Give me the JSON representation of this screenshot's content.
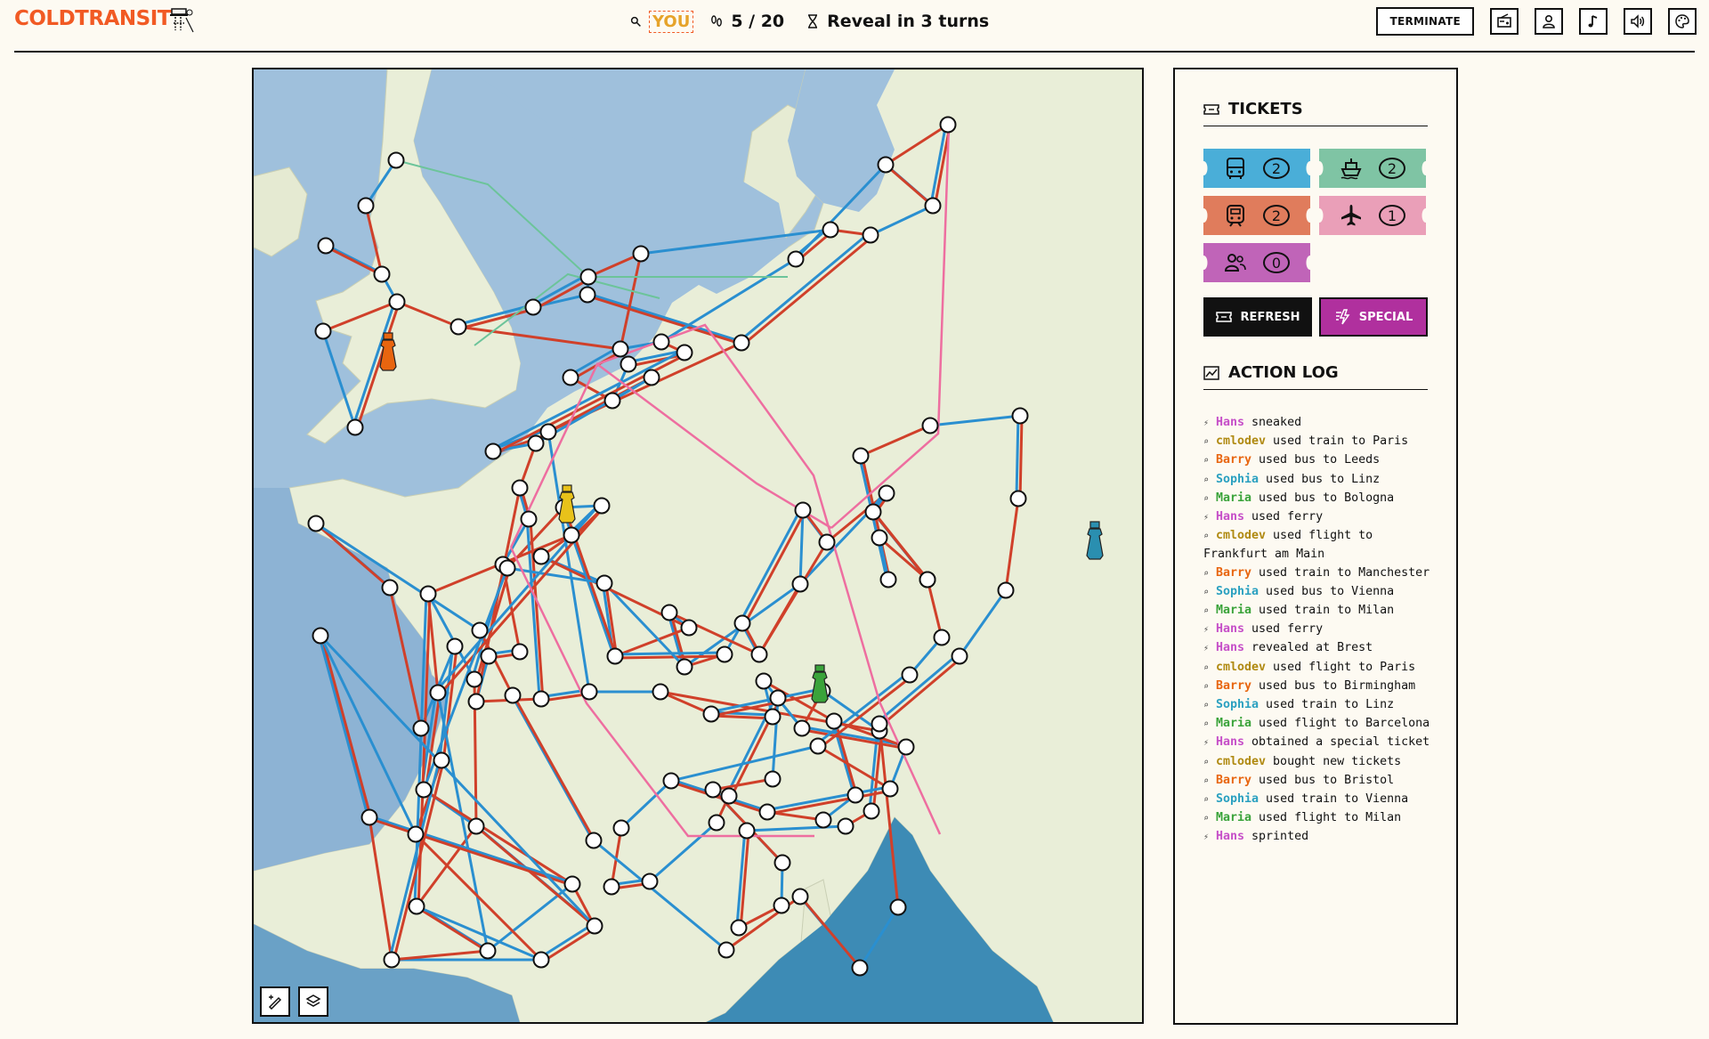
{
  "app": {
    "logo_text": "COLDTRANSIT"
  },
  "hud": {
    "player_tag": "YOU",
    "round_text": "5 / 20",
    "reveal_text": "Reveal in 3 turns"
  },
  "header": {
    "terminate_label": "TERMINATE",
    "icon_buttons": [
      "radio-icon",
      "profile-icon",
      "music-icon",
      "volume-icon",
      "palette-icon"
    ]
  },
  "map": {
    "controls": [
      "draw-tool-icon",
      "layers-icon"
    ],
    "players": [
      {
        "name": "Barry",
        "color": "#e8650f",
        "location": "Bristol"
      },
      {
        "name": "cmlodev",
        "color": "#e8c21a",
        "location": "Paris"
      },
      {
        "name": "Maria",
        "color": "#3aa33a",
        "location": "Milan"
      },
      {
        "name": "Sophia",
        "color": "#2a8fb0",
        "location": "Vienna"
      }
    ],
    "route_colors": {
      "train": "#d0402a",
      "bus": "#2a8fd0",
      "ferry": "#6cc49a",
      "flight": "#ee6ea0"
    }
  },
  "tickets": {
    "title": "TICKETS",
    "items": [
      {
        "type": "bus-icon",
        "count": "2",
        "color": "#4aaed8"
      },
      {
        "type": "ferry-icon",
        "count": "2",
        "color": "#7fc4a4"
      },
      {
        "type": "train-icon",
        "count": "2",
        "color": "#e07c5c"
      },
      {
        "type": "flight-icon",
        "count": "1",
        "color": "#ea9fb8"
      },
      {
        "type": "sneak-icon",
        "count": "0",
        "color": "#c064b8"
      }
    ],
    "refresh_label": "REFRESH",
    "special_label": "SPECIAL",
    "refresh_color": "#111111",
    "special_color": "#b0309e"
  },
  "action_log": {
    "title": "ACTION LOG",
    "player_colors": {
      "Hans": "#c64fc8",
      "cmlodev": "#b08a12",
      "Barry": "#e8650f",
      "Sophia": "#2aa0c0",
      "Maria": "#3aa33a"
    },
    "entries": [
      {
        "icon": "⚡",
        "who": "Hans",
        "text": " sneaked"
      },
      {
        "icon": "🔍",
        "who": "cmlodev",
        "text": " used train to Paris"
      },
      {
        "icon": "🔍",
        "who": "Barry",
        "text": " used bus to Leeds"
      },
      {
        "icon": "🔍",
        "who": "Sophia",
        "text": " used bus to Linz"
      },
      {
        "icon": "🔍",
        "who": "Maria",
        "text": " used bus to Bologna"
      },
      {
        "icon": "⚡",
        "who": "Hans",
        "text": " used ferry"
      },
      {
        "icon": "🔍",
        "who": "cmlodev",
        "text": " used flight to Frankfurt am Main"
      },
      {
        "icon": "🔍",
        "who": "Barry",
        "text": " used train to Manchester"
      },
      {
        "icon": "🔍",
        "who": "Sophia",
        "text": " used bus to Vienna"
      },
      {
        "icon": "🔍",
        "who": "Maria",
        "text": " used train to Milan"
      },
      {
        "icon": "⚡",
        "who": "Hans",
        "text": " used ferry"
      },
      {
        "icon": "⚡",
        "who": "Hans",
        "text": " revealed at Brest"
      },
      {
        "icon": "🔍",
        "who": "cmlodev",
        "text": " used flight to Paris"
      },
      {
        "icon": "🔍",
        "who": "Barry",
        "text": " used bus to Birmingham"
      },
      {
        "icon": "🔍",
        "who": "Sophia",
        "text": " used train to Linz"
      },
      {
        "icon": "🔍",
        "who": "Maria",
        "text": " used flight to Barcelona"
      },
      {
        "icon": "⚡",
        "who": "Hans",
        "text": " obtained a special ticket"
      },
      {
        "icon": "🔍",
        "who": "cmlodev",
        "text": " bought new tickets"
      },
      {
        "icon": "🔍",
        "who": "Barry",
        "text": " used bus to Bristol"
      },
      {
        "icon": "🔍",
        "who": "Sophia",
        "text": " used train to Vienna"
      },
      {
        "icon": "🔍",
        "who": "Maria",
        "text": " used flight to Milan"
      },
      {
        "icon": "⚡",
        "who": "Hans",
        "text": " sprinted"
      }
    ]
  }
}
